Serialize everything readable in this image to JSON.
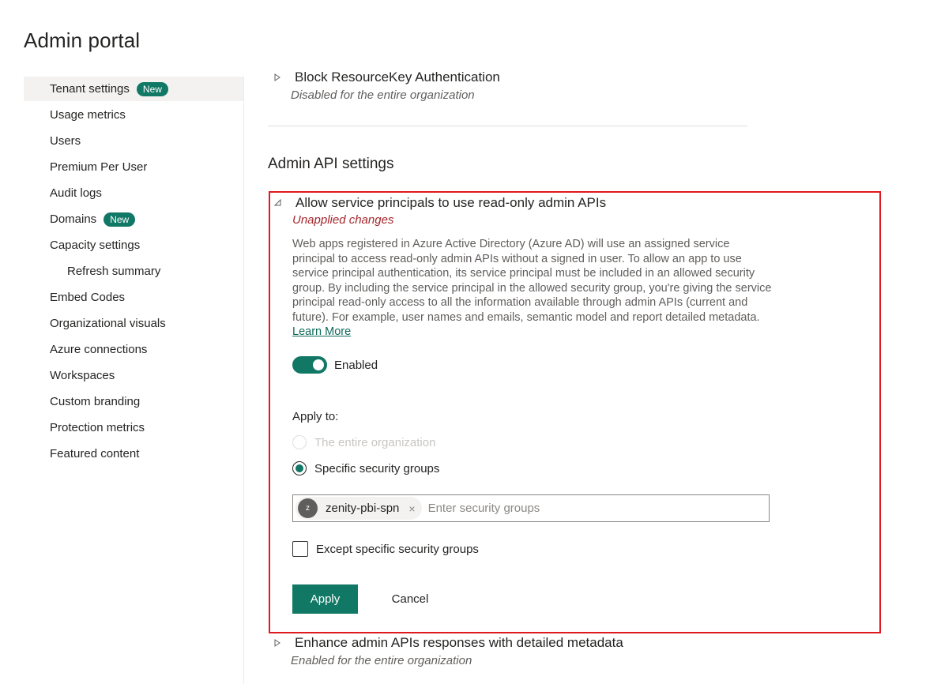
{
  "page": {
    "title": "Admin portal"
  },
  "sidebar": {
    "items": [
      {
        "label": "Tenant settings",
        "badge": "New"
      },
      {
        "label": "Usage metrics"
      },
      {
        "label": "Users"
      },
      {
        "label": "Premium Per User"
      },
      {
        "label": "Audit logs"
      },
      {
        "label": "Domains",
        "badge": "New"
      },
      {
        "label": "Capacity settings"
      },
      {
        "label": "Refresh summary"
      },
      {
        "label": "Embed Codes"
      },
      {
        "label": "Organizational visuals"
      },
      {
        "label": "Azure connections"
      },
      {
        "label": "Workspaces"
      },
      {
        "label": "Custom branding"
      },
      {
        "label": "Protection metrics"
      },
      {
        "label": "Featured content"
      }
    ]
  },
  "main": {
    "prev_setting": {
      "title": "Block ResourceKey Authentication",
      "status": "Disabled for the entire organization"
    },
    "section_title": "Admin API settings",
    "active_setting": {
      "title": "Allow service principals to use read-only admin APIs",
      "status": "Unapplied changes",
      "description": "Web apps registered in Azure Active Directory (Azure AD) will use an assigned service principal to access read-only admin APIs without a signed in user. To allow an app to use service principal authentication, its service principal must be included in an allowed security group. By including the service principal in the allowed security group, you're giving the service principal read-only access to all the information available through admin APIs (current and future). For example, user names and emails, semantic model and report detailed metadata.",
      "learn_more": "Learn More",
      "toggle_label": "Enabled",
      "toggle_state": "on",
      "apply_to_label": "Apply to:",
      "radio_entire_org": "The entire organization",
      "radio_specific": "Specific security groups",
      "selected_option": "Specific security groups",
      "chip_initial": "z",
      "chip_label": "zenity-pbi-spn",
      "chip_remove": "×",
      "group_input_placeholder": "Enter security groups",
      "except_label": "Except specific security groups",
      "except_checked": false,
      "apply_button": "Apply",
      "cancel_button": "Cancel"
    },
    "next_setting": {
      "title": "Enhance admin APIs responses with detailed metadata",
      "status": "Enabled for the entire organization"
    }
  },
  "colors": {
    "accent": "#117865",
    "highlight_border": "#e0191e",
    "unapplied": "#a4262c"
  },
  "icons": {
    "collapsed": "chevron-right-icon",
    "expanded": "chevron-down-icon",
    "remove": "close-icon"
  }
}
